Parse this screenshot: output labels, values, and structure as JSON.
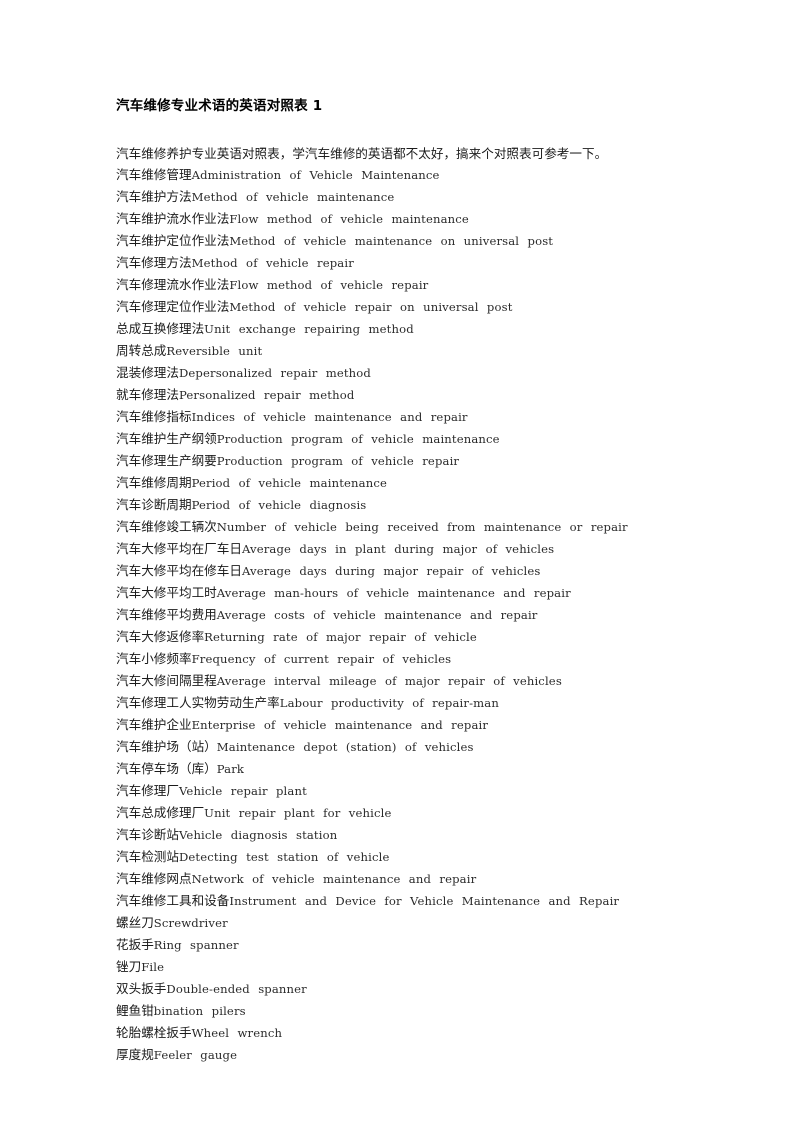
{
  "document": {
    "title": "汽车维修专业术语的英语对照表 1",
    "intro": "汽车维修养护专业英语对照表，学汽车维修的英语都不太好，搞来个对照表可参考一下。",
    "terms": [
      {
        "zh": "汽车维修管理",
        "en": "Administration  of  Vehicle  Maintenance"
      },
      {
        "zh": "汽车维护方法",
        "en": "Method  of  vehicle  maintenance"
      },
      {
        "zh": "汽车维护流水作业法",
        "en": "Flow  method  of  vehicle  maintenance"
      },
      {
        "zh": "汽车维护定位作业法",
        "en": "Method  of  vehicle  maintenance  on  universal  post"
      },
      {
        "zh": "汽车修理方法",
        "en": "Method  of  vehicle  repair"
      },
      {
        "zh": "汽车修理流水作业法",
        "en": "Flow  method  of  vehicle  repair"
      },
      {
        "zh": "汽车修理定位作业法",
        "en": "Method  of  vehicle  repair  on  universal  post"
      },
      {
        "zh": "总成互换修理法",
        "en": "Unit  exchange  repairing  method"
      },
      {
        "zh": "周转总成",
        "en": "Reversible  unit"
      },
      {
        "zh": "混装修理法",
        "en": "Depersonalized  repair  method"
      },
      {
        "zh": "就车修理法",
        "en": "Personalized  repair  method"
      },
      {
        "zh": "汽车维修指标",
        "en": "Indices  of  vehicle  maintenance  and  repair"
      },
      {
        "zh": "汽车维护生产纲领",
        "en": "Production  program  of  vehicle  maintenance"
      },
      {
        "zh": "汽车修理生产纲要",
        "en": "Production  program  of  vehicle  repair"
      },
      {
        "zh": "汽车维修周期",
        "en": "Period  of  vehicle  maintenance"
      },
      {
        "zh": "汽车诊断周期",
        "en": "Period  of  vehicle  diagnosis"
      },
      {
        "zh": "汽车维修竣工辆次",
        "en": "Number  of  vehicle  being  received  from  maintenance  or  repair"
      },
      {
        "zh": "汽车大修平均在厂车日",
        "en": "Average  days  in  plant  during  major  of  vehicles"
      },
      {
        "zh": "汽车大修平均在修车日",
        "en": "Average  days  during  major  repair  of  vehicles"
      },
      {
        "zh": "汽车大修平均工时",
        "en": "Average  man-hours  of  vehicle  maintenance  and  repair"
      },
      {
        "zh": "汽车维修平均费用",
        "en": "Average  costs  of  vehicle  maintenance  and  repair"
      },
      {
        "zh": "汽车大修返修率",
        "en": "Returning  rate  of  major  repair  of  vehicle"
      },
      {
        "zh": "汽车小修频率",
        "en": "Frequency  of  current  repair  of  vehicles"
      },
      {
        "zh": "汽车大修间隔里程",
        "en": "Average  interval  mileage  of  major  repair  of  vehicles"
      },
      {
        "zh": "汽车修理工人实物劳动生产率",
        "en": "Labour  productivity  of  repair-man"
      },
      {
        "zh": "汽车维护企业",
        "en": "Enterprise  of  vehicle  maintenance  and  repair"
      },
      {
        "zh": "汽车维护场（站）",
        "en": "Maintenance  depot  (station)  of  vehicles"
      },
      {
        "zh": "汽车停车场（库）",
        "en": "Park"
      },
      {
        "zh": "汽车修理厂",
        "en": "Vehicle  repair  plant"
      },
      {
        "zh": "汽车总成修理厂",
        "en": "Unit  repair  plant  for  vehicle"
      },
      {
        "zh": "汽车诊断站",
        "en": "Vehicle  diagnosis  station"
      },
      {
        "zh": "汽车检测站",
        "en": "Detecting  test  station  of  vehicle"
      },
      {
        "zh": "汽车维修网点",
        "en": "Network  of  vehicle  maintenance  and  repair"
      },
      {
        "zh": "汽车维修工具和设备",
        "en": "Instrument  and  Device  for  Vehicle  Maintenance  and  Repair"
      },
      {
        "zh": "螺丝刀",
        "en": "Screwdriver"
      },
      {
        "zh": "花扳手",
        "en": "Ring  spanner"
      },
      {
        "zh": "锉刀",
        "en": "File"
      },
      {
        "zh": "双头扳手",
        "en": "Double-ended  spanner"
      },
      {
        "zh": "鲤鱼钳",
        "en": "bination  pilers"
      },
      {
        "zh": "轮胎螺栓扳手",
        "en": "Wheel  wrench"
      },
      {
        "zh": "厚度规",
        "en": "Feeler  gauge"
      }
    ]
  }
}
